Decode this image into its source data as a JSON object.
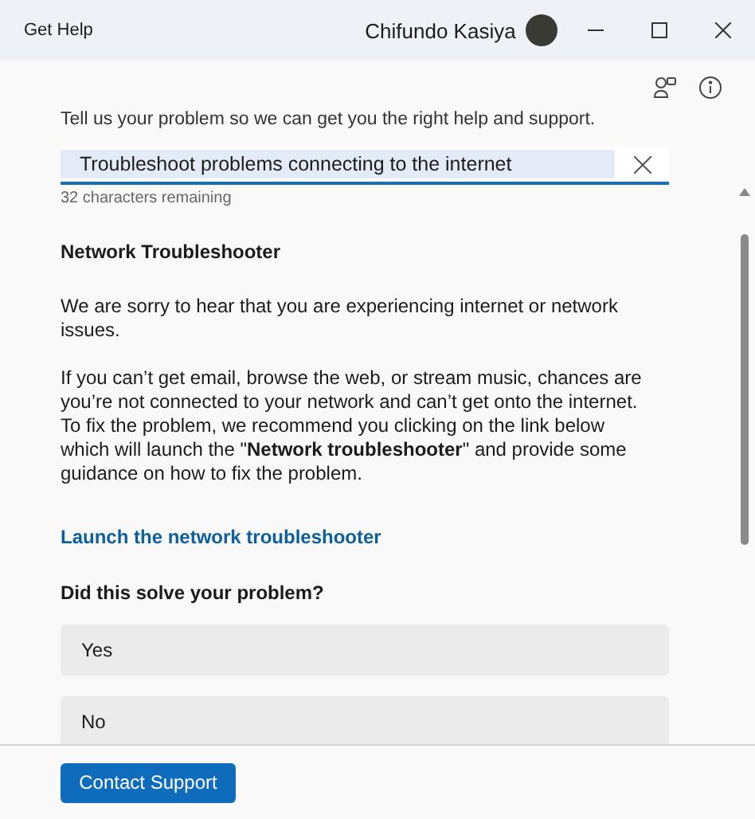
{
  "window": {
    "title": "Get Help",
    "user_name": "Chifundo Kasiya"
  },
  "intro": "Tell us your problem so we can get you the right help and support.",
  "problem_field": {
    "value": "Troubleshoot problems connecting to the internet",
    "counter": "32 characters remaining"
  },
  "article": {
    "heading": "Network Troubleshooter",
    "paragraphs": [
      "We are sorry to hear that you are experiencing internet or network issues.",
      "If you can’t get email, browse the web, or stream music, chances are you’re not connected to your network and can’t get onto the internet. To fix the problem, we recommend you clicking on the link below which will launch the \"**Network troubleshooter**\" and provide some guidance on how to fix the problem."
    ],
    "link": "Launch the network troubleshooter"
  },
  "feedback": {
    "question": "Did this solve your problem?",
    "options": [
      "Yes",
      "No"
    ]
  },
  "footer": {
    "button": "Contact Support"
  }
}
